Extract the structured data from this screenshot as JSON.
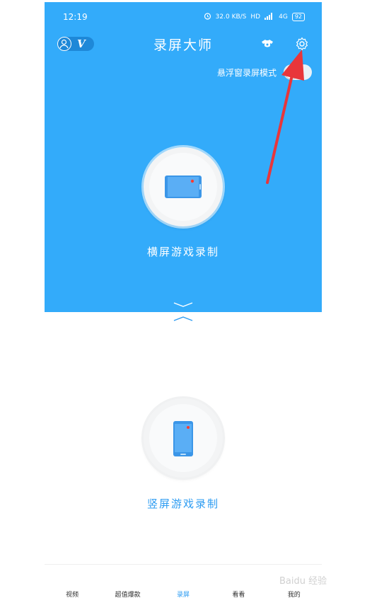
{
  "status_bar": {
    "time": "12:19",
    "speed": "32.0 KB/S",
    "hd": "HD",
    "signal": "4G",
    "battery": "92"
  },
  "header": {
    "title": "录屏大师",
    "vip_badge": "V"
  },
  "floating_mode": {
    "label": "悬浮窗录屏模式",
    "enabled": false
  },
  "landscape": {
    "label": "横屏游戏录制"
  },
  "portrait": {
    "label": "竖屏游戏录制"
  },
  "tabs": [
    {
      "label": "视频"
    },
    {
      "label": "超值爆款"
    },
    {
      "label": "录屏",
      "active": true
    },
    {
      "label": "看看"
    },
    {
      "label": "我的"
    }
  ],
  "watermark": "Baidu 经验",
  "colors": {
    "primary_blue": "#33abfa",
    "accent_blue": "#2d9cf2",
    "annotation_red": "#e8363b"
  },
  "icons": [
    "alarm-icon",
    "signal-icon",
    "battery-icon",
    "user-avatar-icon",
    "skin-icon",
    "settings-gear-icon",
    "landscape-phone-icon",
    "portrait-phone-icon",
    "chevron-down-icon",
    "chevron-up-icon"
  ]
}
